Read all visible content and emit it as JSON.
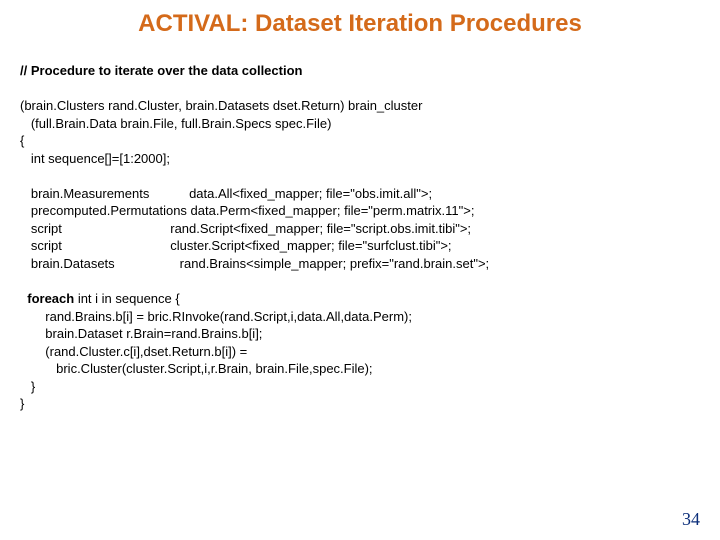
{
  "title": "ACTIVAL: Dataset Iteration Procedures",
  "code": {
    "comment": "// Procedure to iterate over the data collection",
    "sig1": "(brain.Clusters rand.Cluster, brain.Datasets dset.Return) brain_cluster",
    "sig2": "   (full.Brain.Data brain.File, full.Brain.Specs spec.File)",
    "open": "{",
    "seq": "   int sequence[]=[1:2000];",
    "d1": "   brain.Measurements           data.All<fixed_mapper; file=\"obs.imit.all\">;",
    "d2": "   precomputed.Permutations data.Perm<fixed_mapper; file=\"perm.matrix.11\">;",
    "d3": "   script                              rand.Script<fixed_mapper; file=\"script.obs.imit.tibi\">;",
    "d4": "   script                              cluster.Script<fixed_mapper; file=\"surfclust.tibi\">;",
    "d5": "   brain.Datasets                  rand.Brains<simple_mapper; prefix=\"rand.brain.set\">;",
    "fe_head": "foreach",
    "fe_rest": " int i in sequence {",
    "l1": "       rand.Brains.b[i] = bric.RInvoke(rand.Script,i,data.All,data.Perm);",
    "l2": "       brain.Dataset r.Brain=rand.Brains.b[i];",
    "l3": "       (rand.Cluster.c[i],dset.Return.b[i]) =",
    "l4": "          bric.Cluster(cluster.Script,i,r.Brain, brain.File,spec.File);",
    "closeInner": "   }",
    "closeOuter": "}"
  },
  "pagenum": "34"
}
